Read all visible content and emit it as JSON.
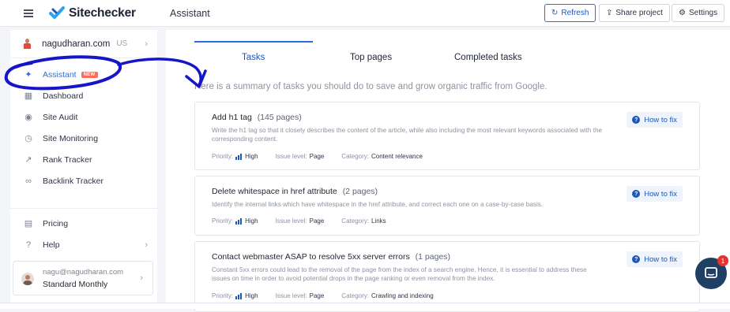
{
  "header": {
    "brand": "Sitechecker",
    "page_title": "Assistant",
    "buttons": [
      {
        "label": "Refresh",
        "icon": "refresh-icon"
      },
      {
        "label": "Share project",
        "icon": "share-icon"
      },
      {
        "label": "Settings",
        "icon": "gear-icon"
      }
    ]
  },
  "sidebar": {
    "site": {
      "name": "nagudharan.com",
      "country": "US"
    },
    "items": [
      {
        "label": "Assistant",
        "badge": "NEW",
        "icon": "wand-icon",
        "active": true
      },
      {
        "label": "Dashboard",
        "icon": "dashboard-icon"
      },
      {
        "label": "Site Audit",
        "icon": "audit-icon"
      },
      {
        "label": "Site Monitoring",
        "icon": "monitoring-icon"
      },
      {
        "label": "Rank Tracker",
        "icon": "rank-icon"
      },
      {
        "label": "Backlink Tracker",
        "icon": "link-icon"
      },
      {
        "label": "Pricing",
        "icon": "pricing-icon"
      },
      {
        "label": "Help",
        "icon": "help-icon"
      }
    ],
    "user": {
      "email": "nagu@nagudharan.com",
      "plan": "Standard Monthly"
    }
  },
  "main": {
    "tabs": [
      "Tasks",
      "Top pages",
      "Completed tasks"
    ],
    "active_tab": "Tasks",
    "intro": "Here is a summary of tasks you should do to save and grow organic traffic from Google.",
    "how_to_fix": "How to fix",
    "meta_labels": {
      "priority": "Priority:",
      "issue_level": "Issue level:",
      "category": "Category:"
    },
    "tasks": [
      {
        "title": "Add h1 tag",
        "count": "(145 pages)",
        "description": "Write the h1 tag so that it closely describes the content of the article, while also including the most relevant keywords associated with the corresponding content.",
        "priority": "High",
        "issue_level": "Page",
        "category": "Content relevance"
      },
      {
        "title": "Delete whitespace in href attribute",
        "count": "(2 pages)",
        "description": "Identify the internal links which have whitespace in the href attribute, and correct each one on a case-by-case basis.",
        "priority": "High",
        "issue_level": "Page",
        "category": "Links"
      },
      {
        "title": "Contact webmaster ASAP to resolve 5xx server errors",
        "count": "(1 pages)",
        "description": "Constant 5xx errors could lead to the removal of the page from the index of a search engine. Hence, it is essential to address these issues on time in order to avoid potential drops in the page ranking or even removal from the index.",
        "priority": "High",
        "issue_level": "Page",
        "category": "Crawling and indexing"
      }
    ]
  },
  "chat": {
    "unread": "1"
  },
  "colors": {
    "accent": "#2d6fd6",
    "annotation": "#1616c8",
    "new_badge": "#ff6b5b",
    "chat": "#1f3f64"
  }
}
